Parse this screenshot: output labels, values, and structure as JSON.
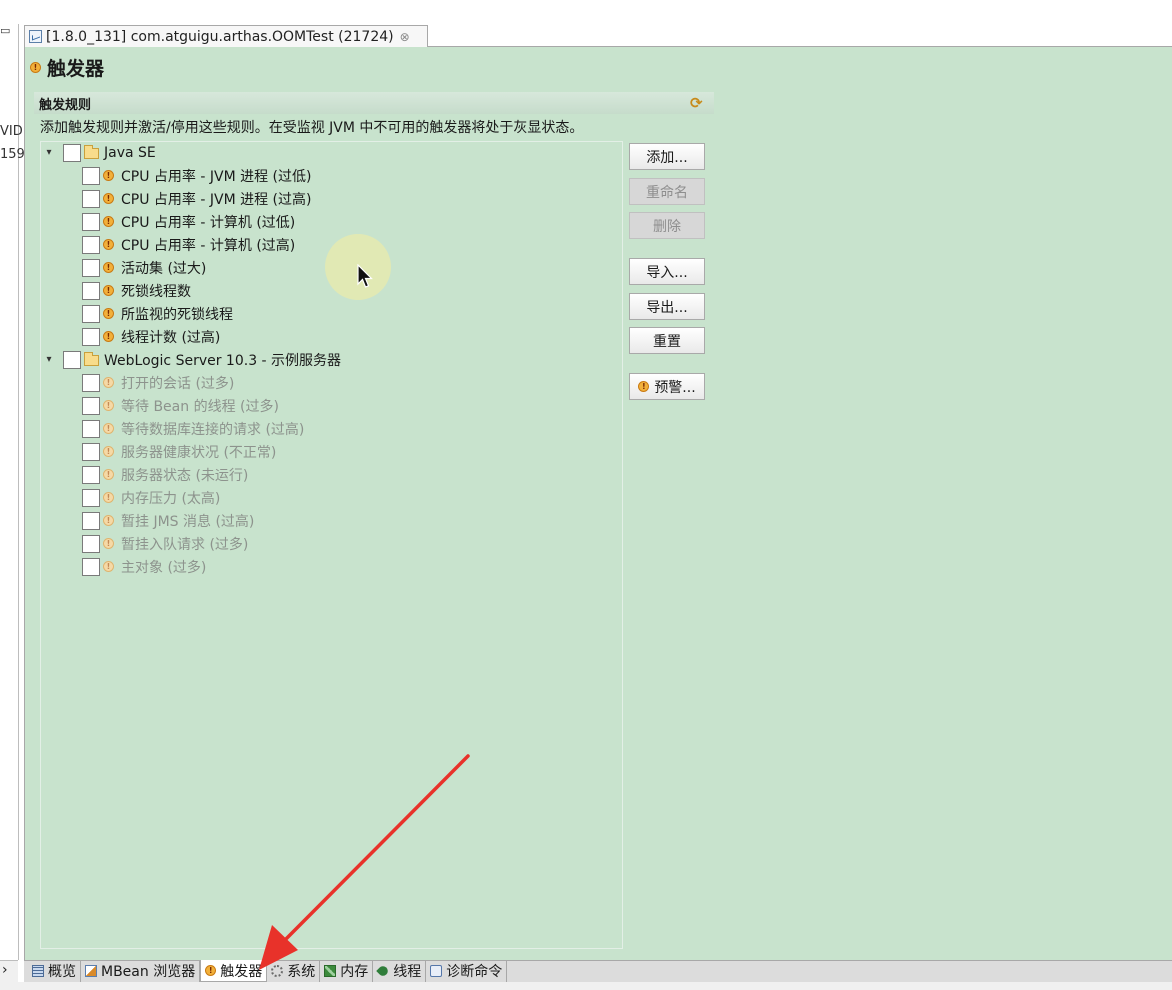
{
  "left_strip": {
    "line1": "VID",
    "line2": "159"
  },
  "editor_tab": {
    "title": "[1.8.0_131] com.atguigu.arthas.OOMTest (21724)",
    "close": "⊗"
  },
  "page": {
    "title": "触发器"
  },
  "section": {
    "title": "触发规则",
    "description": "添加触发规则并激活/停用这些规则。在受监视 JVM 中不可用的触发器将处于灰显状态。"
  },
  "tree": {
    "groups": [
      {
        "label": "Java SE",
        "enabled": true,
        "items": [
          "CPU 占用率 - JVM 进程 (过低)",
          "CPU 占用率 - JVM 进程 (过高)",
          "CPU 占用率 - 计算机 (过低)",
          "CPU 占用率 - 计算机 (过高)",
          "活动集 (过大)",
          "死锁线程数",
          "所监视的死锁线程",
          "线程计数 (过高)"
        ]
      },
      {
        "label": "WebLogic Server 10.3 - 示例服务器",
        "enabled": false,
        "items": [
          "打开的会话 (过多)",
          "等待 Bean 的线程 (过多)",
          "等待数据库连接的请求 (过高)",
          "服务器健康状况 (不正常)",
          "服务器状态 (未运行)",
          "内存压力 (太高)",
          "暂挂 JMS 消息 (过高)",
          "暂挂入队请求 (过多)",
          "主对象 (过多)"
        ]
      }
    ]
  },
  "buttons": {
    "add": "添加...",
    "rename": "重命名",
    "delete": "删除",
    "import": "导入...",
    "export": "导出...",
    "reset": "重置",
    "alerts": "预警..."
  },
  "bottom_tabs": [
    {
      "label": "概览",
      "icon": "overview-icon"
    },
    {
      "label": "MBean 浏览器",
      "icon": "mbean-icon"
    },
    {
      "label": "触发器",
      "icon": "warning-icon",
      "active": true
    },
    {
      "label": "系统",
      "icon": "system-icon"
    },
    {
      "label": "内存",
      "icon": "memory-icon"
    },
    {
      "label": "线程",
      "icon": "threads-icon"
    },
    {
      "label": "诊断命令",
      "icon": "diagnostic-icon"
    }
  ],
  "colors": {
    "panel_bg": "#c8e3cd",
    "warning": "#f2b03a",
    "arrow": "#e8322a"
  }
}
